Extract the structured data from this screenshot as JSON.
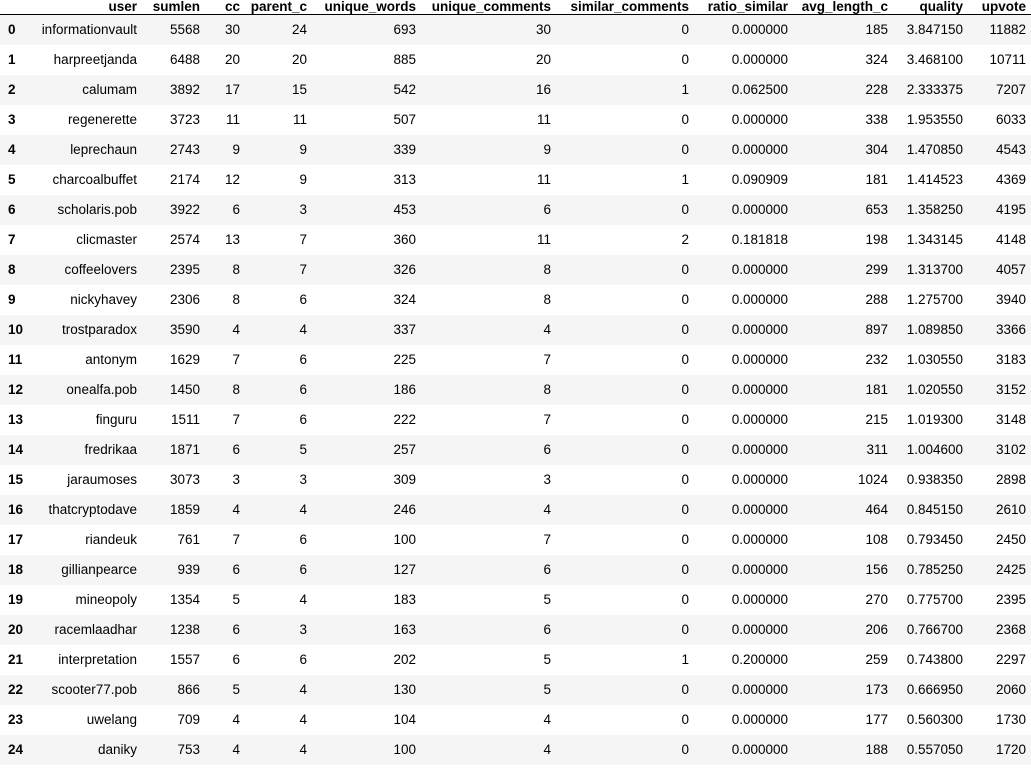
{
  "table": {
    "index_header": "",
    "columns": [
      "user",
      "sumlen",
      "cc",
      "parent_c",
      "unique_words",
      "unique_comments",
      "similar_comments",
      "ratio_similar",
      "avg_length_c",
      "quality",
      "upvote"
    ],
    "rows": [
      {
        "index": "0",
        "cells": [
          "informationvault",
          "5568",
          "30",
          "24",
          "693",
          "30",
          "0",
          "0.000000",
          "185",
          "3.847150",
          "11882"
        ]
      },
      {
        "index": "1",
        "cells": [
          "harpreetjanda",
          "6488",
          "20",
          "20",
          "885",
          "20",
          "0",
          "0.000000",
          "324",
          "3.468100",
          "10711"
        ]
      },
      {
        "index": "2",
        "cells": [
          "calumam",
          "3892",
          "17",
          "15",
          "542",
          "16",
          "1",
          "0.062500",
          "228",
          "2.333375",
          "7207"
        ]
      },
      {
        "index": "3",
        "cells": [
          "regenerette",
          "3723",
          "11",
          "11",
          "507",
          "11",
          "0",
          "0.000000",
          "338",
          "1.953550",
          "6033"
        ]
      },
      {
        "index": "4",
        "cells": [
          "leprechaun",
          "2743",
          "9",
          "9",
          "339",
          "9",
          "0",
          "0.000000",
          "304",
          "1.470850",
          "4543"
        ]
      },
      {
        "index": "5",
        "cells": [
          "charcoalbuffet",
          "2174",
          "12",
          "9",
          "313",
          "11",
          "1",
          "0.090909",
          "181",
          "1.414523",
          "4369"
        ]
      },
      {
        "index": "6",
        "cells": [
          "scholaris.pob",
          "3922",
          "6",
          "3",
          "453",
          "6",
          "0",
          "0.000000",
          "653",
          "1.358250",
          "4195"
        ]
      },
      {
        "index": "7",
        "cells": [
          "clicmaster",
          "2574",
          "13",
          "7",
          "360",
          "11",
          "2",
          "0.181818",
          "198",
          "1.343145",
          "4148"
        ]
      },
      {
        "index": "8",
        "cells": [
          "coffeelovers",
          "2395",
          "8",
          "7",
          "326",
          "8",
          "0",
          "0.000000",
          "299",
          "1.313700",
          "4057"
        ]
      },
      {
        "index": "9",
        "cells": [
          "nickyhavey",
          "2306",
          "8",
          "6",
          "324",
          "8",
          "0",
          "0.000000",
          "288",
          "1.275700",
          "3940"
        ]
      },
      {
        "index": "10",
        "cells": [
          "trostparadox",
          "3590",
          "4",
          "4",
          "337",
          "4",
          "0",
          "0.000000",
          "897",
          "1.089850",
          "3366"
        ]
      },
      {
        "index": "11",
        "cells": [
          "antonym",
          "1629",
          "7",
          "6",
          "225",
          "7",
          "0",
          "0.000000",
          "232",
          "1.030550",
          "3183"
        ]
      },
      {
        "index": "12",
        "cells": [
          "onealfa.pob",
          "1450",
          "8",
          "6",
          "186",
          "8",
          "0",
          "0.000000",
          "181",
          "1.020550",
          "3152"
        ]
      },
      {
        "index": "13",
        "cells": [
          "finguru",
          "1511",
          "7",
          "6",
          "222",
          "7",
          "0",
          "0.000000",
          "215",
          "1.019300",
          "3148"
        ]
      },
      {
        "index": "14",
        "cells": [
          "fredrikaa",
          "1871",
          "6",
          "5",
          "257",
          "6",
          "0",
          "0.000000",
          "311",
          "1.004600",
          "3102"
        ]
      },
      {
        "index": "15",
        "cells": [
          "jaraumoses",
          "3073",
          "3",
          "3",
          "309",
          "3",
          "0",
          "0.000000",
          "1024",
          "0.938350",
          "2898"
        ]
      },
      {
        "index": "16",
        "cells": [
          "thatcryptodave",
          "1859",
          "4",
          "4",
          "246",
          "4",
          "0",
          "0.000000",
          "464",
          "0.845150",
          "2610"
        ]
      },
      {
        "index": "17",
        "cells": [
          "riandeuk",
          "761",
          "7",
          "6",
          "100",
          "7",
          "0",
          "0.000000",
          "108",
          "0.793450",
          "2450"
        ]
      },
      {
        "index": "18",
        "cells": [
          "gillianpearce",
          "939",
          "6",
          "6",
          "127",
          "6",
          "0",
          "0.000000",
          "156",
          "0.785250",
          "2425"
        ]
      },
      {
        "index": "19",
        "cells": [
          "mineopoly",
          "1354",
          "5",
          "4",
          "183",
          "5",
          "0",
          "0.000000",
          "270",
          "0.775700",
          "2395"
        ]
      },
      {
        "index": "20",
        "cells": [
          "racemlaadhar",
          "1238",
          "6",
          "3",
          "163",
          "6",
          "0",
          "0.000000",
          "206",
          "0.766700",
          "2368"
        ]
      },
      {
        "index": "21",
        "cells": [
          "interpretation",
          "1557",
          "6",
          "6",
          "202",
          "5",
          "1",
          "0.200000",
          "259",
          "0.743800",
          "2297"
        ]
      },
      {
        "index": "22",
        "cells": [
          "scooter77.pob",
          "866",
          "5",
          "4",
          "130",
          "5",
          "0",
          "0.000000",
          "173",
          "0.666950",
          "2060"
        ]
      },
      {
        "index": "23",
        "cells": [
          "uwelang",
          "709",
          "4",
          "4",
          "104",
          "4",
          "0",
          "0.000000",
          "177",
          "0.560300",
          "1730"
        ]
      },
      {
        "index": "24",
        "cells": [
          "daniky",
          "753",
          "4",
          "4",
          "100",
          "4",
          "0",
          "0.000000",
          "188",
          "0.557050",
          "1720"
        ]
      }
    ]
  }
}
